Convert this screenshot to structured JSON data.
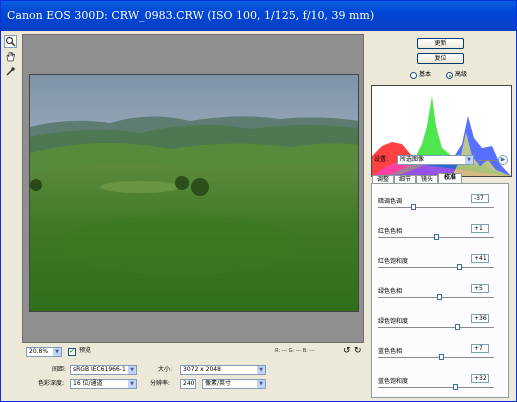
{
  "window": {
    "title": "Canon EOS 300D:  CRW_0983.CRW  (ISO 100, 1/125, f/10, 39 mm)"
  },
  "toolbar": {
    "tools": [
      {
        "name": "zoom-icon"
      },
      {
        "name": "hand-icon"
      },
      {
        "name": "eyedropper-icon"
      }
    ]
  },
  "bottom": {
    "zoom_value": "20.8%",
    "preview_label": "预览",
    "preview_checked": true,
    "rgb_readout": "R: ---  G: ---  B: ---"
  },
  "workflow": {
    "space_label": "间距:",
    "space_value": "sRGB IEC61966-1",
    "size_label": "大小:",
    "size_value": "3072 x 2048",
    "depth_label": "色彩深度:",
    "depth_value": "16 位/通道",
    "resolution_label": "分辨率:",
    "resolution_value": "240",
    "resolution_unit": "像素/英寸"
  },
  "panel": {
    "update_label": "更新",
    "reset_label": "复位",
    "mode_basic": "基本",
    "mode_advanced": "高级",
    "settings_label": "设置:",
    "settings_value": "所选图像",
    "tabs": [
      "调整",
      "细节",
      "镜头",
      "校准"
    ],
    "active_tab": 3,
    "calibration": [
      {
        "label": "暗调色调",
        "value": "-37",
        "pos": 0.3
      },
      {
        "label": "红色色相",
        "value": "+1",
        "pos": 0.5
      },
      {
        "label": "红色饱和度",
        "value": "+41",
        "pos": 0.7
      },
      {
        "label": "绿色色相",
        "value": "+5",
        "pos": 0.53
      },
      {
        "label": "绿色饱和度",
        "value": "+36",
        "pos": 0.68
      },
      {
        "label": "蓝色色相",
        "value": "+7",
        "pos": 0.54
      },
      {
        "label": "蓝色饱和度",
        "value": "+32",
        "pos": 0.66
      }
    ]
  },
  "colors": {
    "title_bar": "#0046d5",
    "canvas_gray": "#8f8f8f",
    "accent_green": "#21a121"
  }
}
